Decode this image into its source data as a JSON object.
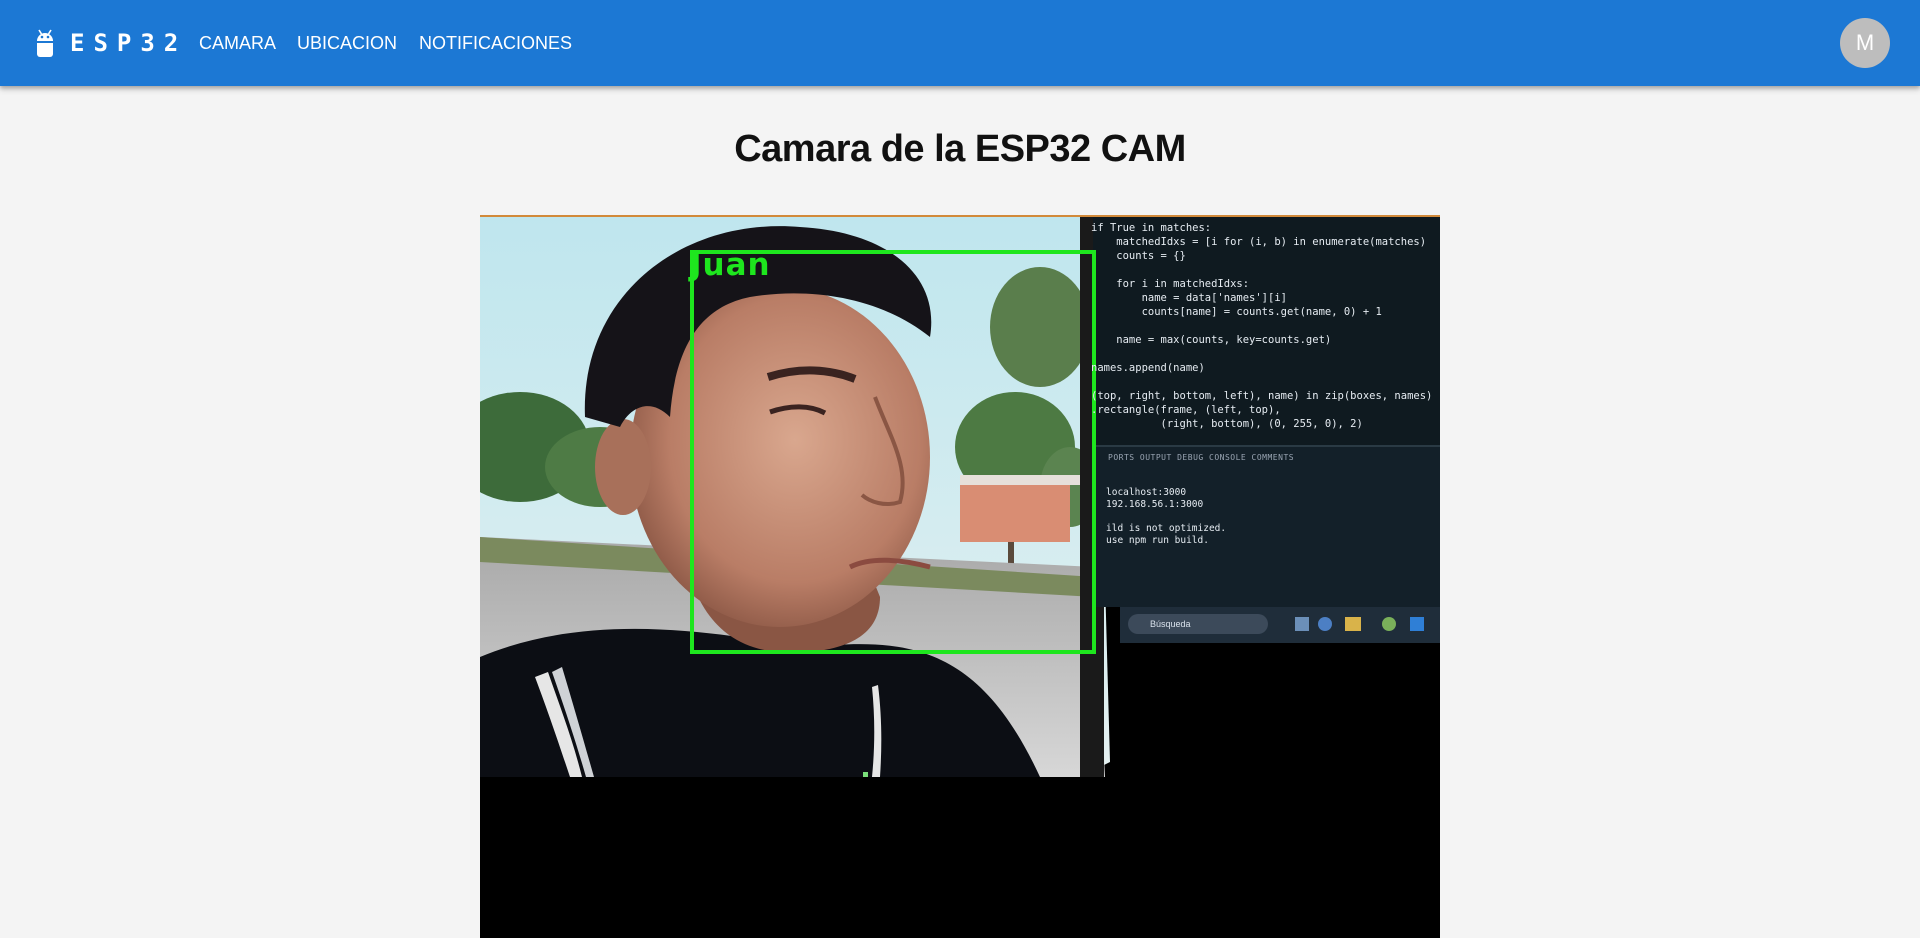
{
  "header": {
    "brand": "ESP32",
    "nav": {
      "camara": "CAMARA",
      "ubicacion": "UBICACION",
      "notificaciones": "NOTIFICACIONES"
    },
    "avatar_initial": "M"
  },
  "main": {
    "title": "Camara de la ESP32 CAM",
    "stream": {
      "detected_name": "Juan",
      "code_lines": "if True in matches:\n    matchedIdxs = [i for (i, b) in enumerate(matches)\n    counts = {}\n\n    for i in matchedIdxs:\n        name = data['names'][i]\n        counts[name] = counts.get(name, 0) + 1\n\n    name = max(counts, key=counts.get)\n\nnames.append(name)\n\n(top, right, bottom, left), name) in zip(boxes, names):\n.rectangle(frame, (left, top),\n           (right, bottom), (0, 255, 0), 2)",
      "panel_tabs": "PORTS   OUTPUT   DEBUG CONSOLE   COMMENTS",
      "terminal_lines": "localhost:3000\n192.168.56.1:3000\n\nild is not optimized.\nuse npm run build.",
      "taskbar_search": "Búsqueda"
    }
  },
  "colors": {
    "appbar": "#1c78d4",
    "background": "#f4f4f4",
    "detection_box": "#1ee61e",
    "avatar": "#bdbdbd"
  },
  "icons": {
    "logo": "android-icon"
  }
}
